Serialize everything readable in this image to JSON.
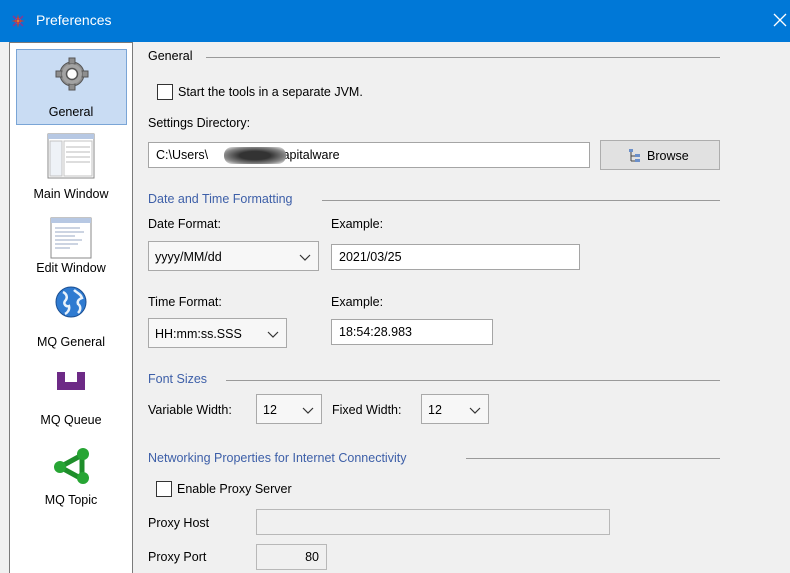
{
  "window": {
    "title": "Preferences",
    "close_glyph": "✕"
  },
  "sidebar": {
    "items": [
      {
        "label": "General",
        "icon": "gear-icon",
        "selected": true
      },
      {
        "label": "Main Window",
        "icon": "main-window-icon",
        "selected": false
      },
      {
        "label": "Edit Window",
        "icon": "edit-window-icon",
        "selected": false
      },
      {
        "label": "MQ General",
        "icon": "globe-icon",
        "selected": false
      },
      {
        "label": "MQ Queue",
        "icon": "queue-icon",
        "selected": false
      },
      {
        "label": "MQ Topic",
        "icon": "topic-icon",
        "selected": false
      }
    ]
  },
  "general": {
    "section_title": "General",
    "separate_jvm_label": "Start the tools in a separate JVM.",
    "separate_jvm_checked": false,
    "settings_dir_label": "Settings Directory:",
    "settings_dir_prefix": "C:\\Users\\",
    "settings_dir_suffix": "\\Capitalware",
    "browse_label": "Browse"
  },
  "datetime": {
    "section_title": "Date and Time Formatting",
    "date_format_label": "Date Format:",
    "date_format_value": "yyyy/MM/dd",
    "date_example_label": "Example:",
    "date_example_value": "2021/03/25",
    "time_format_label": "Time Format:",
    "time_format_value": "HH:mm:ss.SSS",
    "time_example_label": "Example:",
    "time_example_value": "18:54:28.983"
  },
  "fonts": {
    "section_title": "Font Sizes",
    "variable_width_label": "Variable Width:",
    "variable_width_value": "12",
    "fixed_width_label": "Fixed Width:",
    "fixed_width_value": "12"
  },
  "network": {
    "section_title": "Networking Properties for Internet Connectivity",
    "enable_proxy_label": "Enable Proxy Server",
    "enable_proxy_checked": false,
    "proxy_host_label": "Proxy Host",
    "proxy_host_value": "",
    "proxy_port_label": "Proxy Port",
    "proxy_port_value": "80"
  },
  "colors": {
    "titlebar": "#0078d7",
    "section_blue": "#3d5fa8",
    "selection": "#c9dcf3"
  }
}
